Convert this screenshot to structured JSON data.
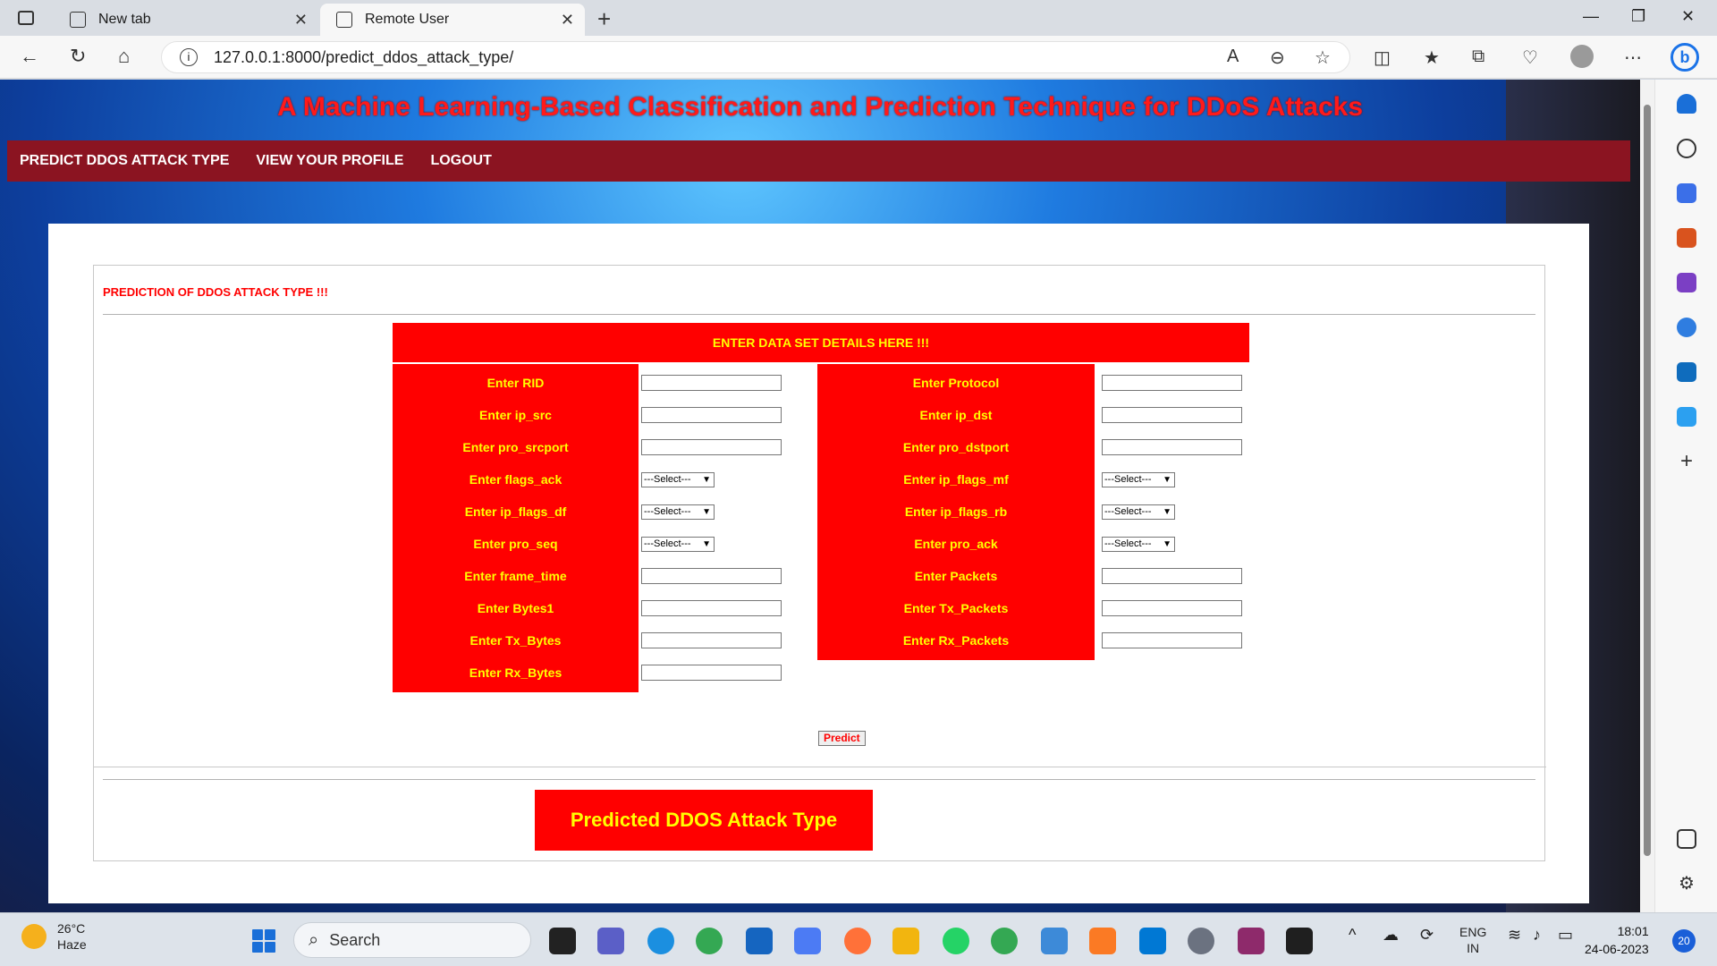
{
  "browser": {
    "tabs": [
      {
        "title": "New tab"
      },
      {
        "title": "Remote User"
      }
    ],
    "url": "127.0.0.1:8000/predict_ddos_attack_type/"
  },
  "page": {
    "title": "A Machine Learning-Based Classification and Prediction Technique for DDoS Attacks",
    "nav": [
      "PREDICT DDOS ATTACK TYPE",
      "VIEW YOUR PROFILE",
      "LOGOUT"
    ],
    "section_title": "PREDICTION OF DDOS ATTACK TYPE !!!",
    "form_header": "ENTER DATA SET DETAILS HERE !!!",
    "fields_left": [
      {
        "label": "Enter RID",
        "type": "text"
      },
      {
        "label": "Enter ip_src",
        "type": "text"
      },
      {
        "label": "Enter pro_srcport",
        "type": "text"
      },
      {
        "label": "Enter flags_ack",
        "type": "select",
        "value": "---Select---"
      },
      {
        "label": "Enter ip_flags_df",
        "type": "select",
        "value": "---Select---"
      },
      {
        "label": "Enter pro_seq",
        "type": "select",
        "value": "---Select---"
      },
      {
        "label": "Enter frame_time",
        "type": "text"
      },
      {
        "label": "Enter Bytes1",
        "type": "text"
      },
      {
        "label": "Enter Tx_Bytes",
        "type": "text"
      },
      {
        "label": "Enter Rx_Bytes",
        "type": "text"
      }
    ],
    "fields_right": [
      {
        "label": "Enter Protocol",
        "type": "text"
      },
      {
        "label": "Enter ip_dst",
        "type": "text"
      },
      {
        "label": "Enter pro_dstport",
        "type": "text"
      },
      {
        "label": "Enter ip_flags_mf",
        "type": "select",
        "value": "---Select---"
      },
      {
        "label": "Enter ip_flags_rb",
        "type": "select",
        "value": "---Select---"
      },
      {
        "label": "Enter pro_ack",
        "type": "select",
        "value": "---Select---"
      },
      {
        "label": "Enter Packets",
        "type": "text"
      },
      {
        "label": "Enter Tx_Packets",
        "type": "text"
      },
      {
        "label": "Enter Rx_Packets",
        "type": "text"
      }
    ],
    "predict_button": "Predict",
    "result_label": "Predicted DDOS Attack Type"
  },
  "taskbar": {
    "weather_temp": "26°C",
    "weather_desc": "Haze",
    "search_placeholder": "Search",
    "lang_line1": "ENG",
    "lang_line2": "IN",
    "time": "18:01",
    "date": "24-06-2023",
    "notification_count": "20"
  },
  "colors": {
    "accent_red": "#ff0000",
    "label_yellow": "#ffff00",
    "nav_bg": "#8b1421"
  }
}
